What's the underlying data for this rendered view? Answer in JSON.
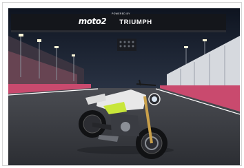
{
  "gantry": {
    "series_logo": "moto2",
    "powered_by": "POWERED BY",
    "brand": "TRIUMPH"
  },
  "colors": {
    "sky": "#1a2030",
    "track": "#3a3c42",
    "pit_wall": "#c94a6e",
    "bike_accent": "#c8e63a",
    "bike_body": "#e8e8e8"
  }
}
